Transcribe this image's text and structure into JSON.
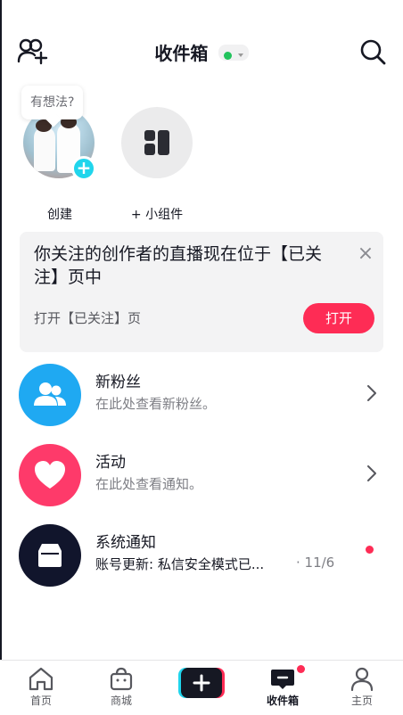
{
  "header": {
    "title": "收件箱",
    "status_color": "#22c35d"
  },
  "stories": {
    "bubble_text": "有想法?",
    "create_label": "创建",
    "widget_label": "+ 小组件"
  },
  "notice": {
    "text": "你关注的创作者的直播现在位于【已关注】页中",
    "sub": "打开【已关注】页",
    "button": "打开",
    "close_glyph": "×"
  },
  "inbox": {
    "items": [
      {
        "title": "新粉丝",
        "subtitle": "在此处查看新粉丝。",
        "icon": "people-icon",
        "color": "#1fa9f2"
      },
      {
        "title": "活动",
        "subtitle": "在此处查看通知。",
        "icon": "heart-icon",
        "color": "#fe3a6a"
      },
      {
        "title": "系统通知",
        "preview": "账号更新: 私信安全模式已...",
        "time": "· 11/6",
        "icon": "inbox-tray-icon",
        "color": "#11152c"
      }
    ]
  },
  "nav": {
    "home": "首页",
    "shop": "商城",
    "inbox": "收件箱",
    "profile": "主页"
  },
  "colors": {
    "accent": "#fe2c55",
    "cyan": "#20d5ec"
  }
}
